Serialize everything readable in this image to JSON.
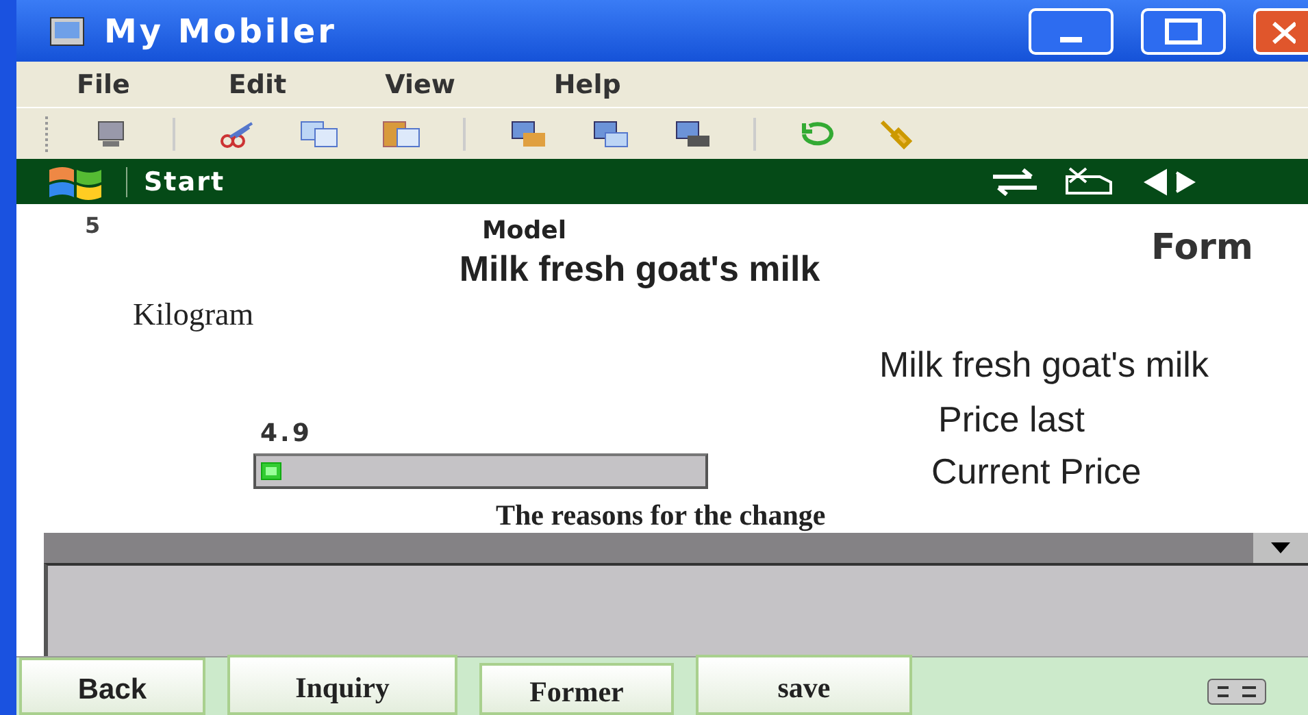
{
  "window": {
    "title": "My Mobiler"
  },
  "menu": [
    "File",
    "Edit",
    "View",
    "Help"
  ],
  "taskbar": {
    "start": "Start"
  },
  "form": {
    "quantity": "5",
    "model_label": "Model",
    "form_label": "Form",
    "product": "Milk fresh goat's milk",
    "unit": "Kilogram",
    "product_right": "Milk fresh goat's milk",
    "price_last_label": "Price last",
    "price_last": "4.9",
    "current_price_label": "Current Price",
    "reasons_label": "The reasons for the change"
  },
  "buttons": [
    "Back",
    "Inquiry",
    "Former",
    "save"
  ]
}
